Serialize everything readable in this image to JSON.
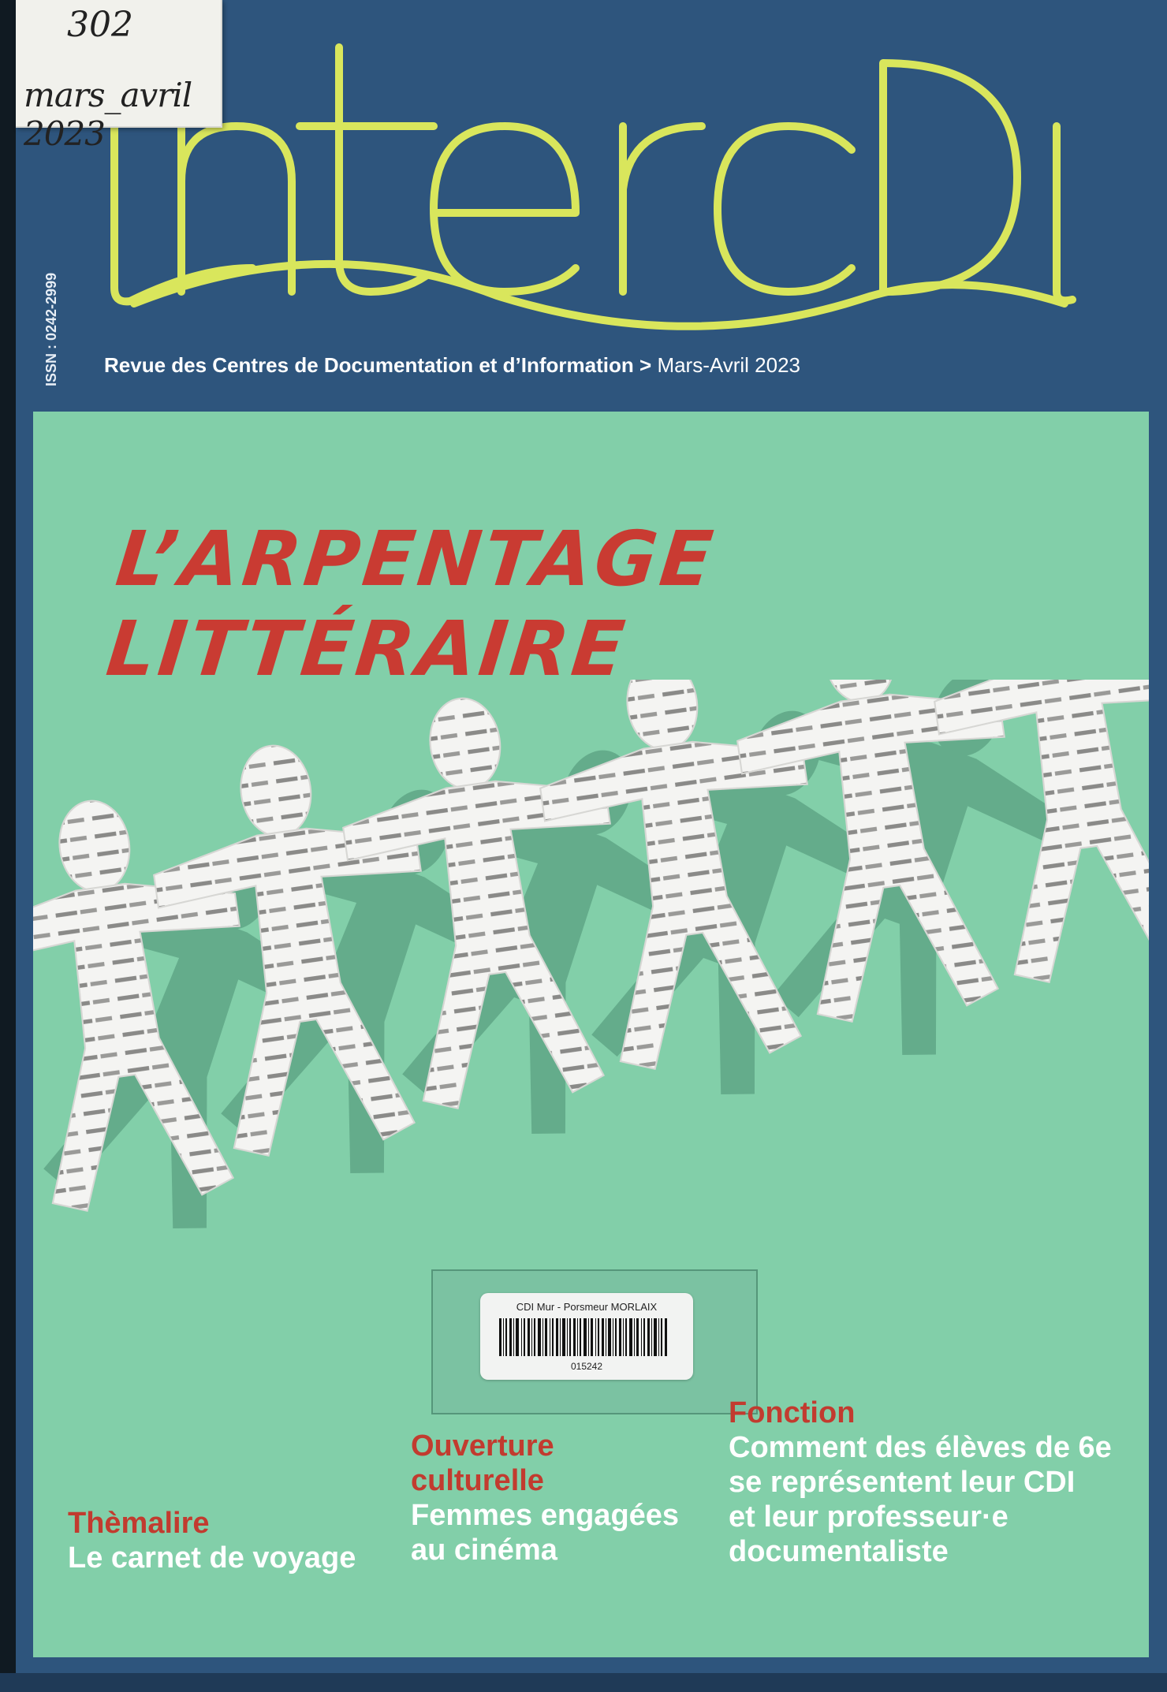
{
  "magazine": {
    "logo_text": "InterCDI",
    "issue_number": "302",
    "issn": "ISSN : 0242-2999",
    "subtitle_bold": "Revue des Centres de Documentation et d’Information",
    "subtitle_separator": ">",
    "subtitle_date": "Mars-Avril 2023",
    "brand_colors": {
      "logo": "#d9e65c",
      "cover": "#2e557d",
      "panel": "#82cfa9",
      "headline": "#c93b32"
    }
  },
  "handwritten_sticker": {
    "line1": "302",
    "line2": "mars_avril 2023"
  },
  "cover_story": {
    "line1": "L’ARPENTAGE",
    "line2": "LITTÉRAIRE"
  },
  "library_label": {
    "library": "CDI Mur - Porsmeur MORLAIX",
    "code": "015242"
  },
  "sections": {
    "fonction": {
      "kicker": "Fonction",
      "title_lines": [
        "Comment des élèves de 6e",
        "se représentent leur CDI",
        "et leur professeur·e",
        "documentaliste"
      ]
    },
    "ouverture": {
      "kicker_lines": [
        "Ouverture",
        "culturelle"
      ],
      "title_lines": [
        "Femmes engagées",
        "au cinéma"
      ]
    },
    "themalire": {
      "kicker": "Thèmalire",
      "title": "Le carnet de voyage"
    }
  }
}
